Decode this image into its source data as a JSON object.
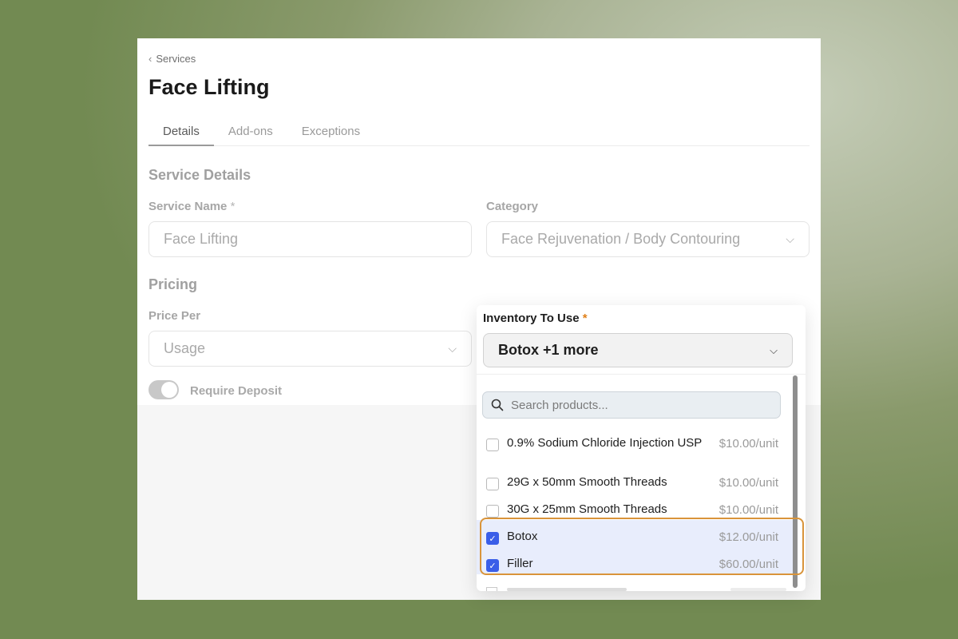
{
  "breadcrumb": {
    "label": "Services"
  },
  "page": {
    "title": "Face Lifting"
  },
  "tabs": [
    {
      "label": "Details",
      "active": true
    },
    {
      "label": "Add-ons",
      "active": false
    },
    {
      "label": "Exceptions",
      "active": false
    }
  ],
  "service_details": {
    "heading": "Service Details",
    "service_name_label": "Service Name",
    "service_name_required": "*",
    "service_name_value": "Face Lifting",
    "category_label": "Category",
    "category_value": "Face Rejuvenation / Body Contouring"
  },
  "pricing": {
    "heading": "Pricing",
    "price_per_label": "Price Per",
    "price_per_value": "Usage",
    "require_deposit_label": "Require Deposit",
    "require_deposit_on": true
  },
  "inventory": {
    "label": "Inventory To Use",
    "required_mark": "*",
    "selected_summary": "Botox +1 more",
    "search_placeholder": "Search products...",
    "items": [
      {
        "name": "0.9% Sodium Chloride Injection USP",
        "price": "$10.00/unit",
        "checked": false
      },
      {
        "name": "29G x 50mm Smooth Threads",
        "price": "$10.00/unit",
        "checked": false
      },
      {
        "name": "30G x 25mm Smooth Threads",
        "price": "$10.00/unit",
        "checked": false
      },
      {
        "name": "Botox",
        "price": "$12.00/unit",
        "checked": true
      },
      {
        "name": "Filler",
        "price": "$60.00/unit",
        "checked": true
      }
    ]
  },
  "colors": {
    "checkbox_accent": "#3a5ee8",
    "required_accent": "#e0801a",
    "highlight_outline": "#d9943a"
  }
}
